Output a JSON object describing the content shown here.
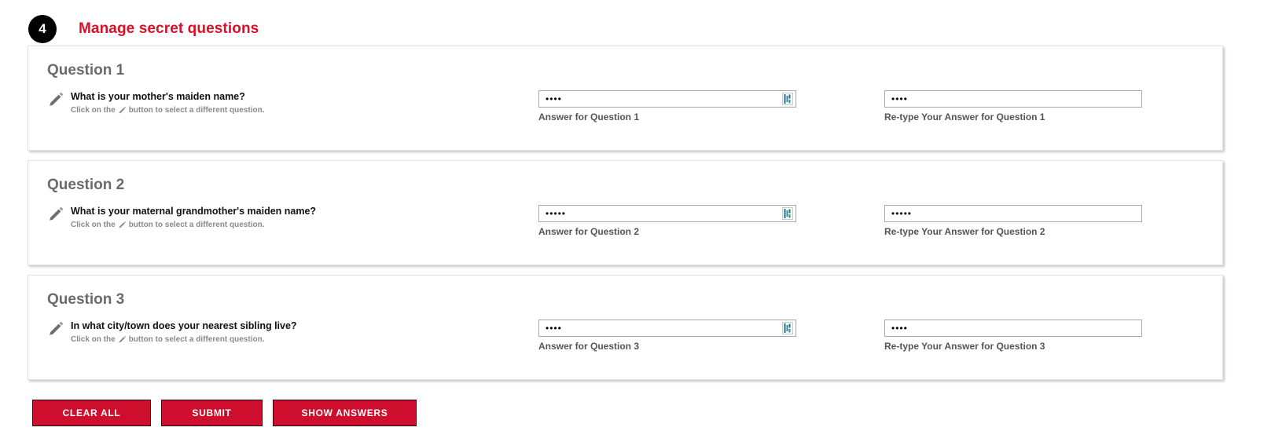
{
  "section": {
    "step_number": "4",
    "title": "Manage secret questions"
  },
  "questions": [
    {
      "card_title": "Question 1",
      "question_text": "What is your mother's maiden name?",
      "hint_prefix": "Click on the",
      "hint_suffix": "button to select a different question.",
      "edit_icon": "pencil-icon",
      "answer": {
        "value": "••••",
        "label": "Answer for Question 1",
        "manager_icon": "password-manager-icon"
      },
      "retype": {
        "value": "••••",
        "label": "Re-type Your Answer for Question 1"
      }
    },
    {
      "card_title": "Question 2",
      "question_text": "What is your maternal grandmother's maiden name?",
      "hint_prefix": "Click on the",
      "hint_suffix": "button to select a different question.",
      "edit_icon": "pencil-icon",
      "answer": {
        "value": "•••••",
        "label": "Answer for Question 2",
        "manager_icon": "password-manager-icon"
      },
      "retype": {
        "value": "•••••",
        "label": "Re-type Your Answer for Question 2"
      }
    },
    {
      "card_title": "Question 3",
      "question_text": "In what city/town does your nearest sibling live?",
      "hint_prefix": "Click on the",
      "hint_suffix": "button to select a different question.",
      "edit_icon": "pencil-icon",
      "answer": {
        "value": "••••",
        "label": "Answer for Question 3",
        "manager_icon": "password-manager-icon"
      },
      "retype": {
        "value": "••••",
        "label": "Re-type Your Answer for Question 3"
      }
    }
  ],
  "buttons": {
    "clear_all": "CLEAR ALL",
    "submit": "SUBMIT",
    "show_answers": "SHOW ANSWERS"
  },
  "colors": {
    "accent_red": "#ce0e2d",
    "title_red": "#d81028",
    "badge_black": "#000000",
    "card_title_gray": "#6b6b6b",
    "label_gray": "#555555",
    "hint_gray": "#8a8a8a",
    "pw_manager_teal": "#1f6f7d"
  }
}
